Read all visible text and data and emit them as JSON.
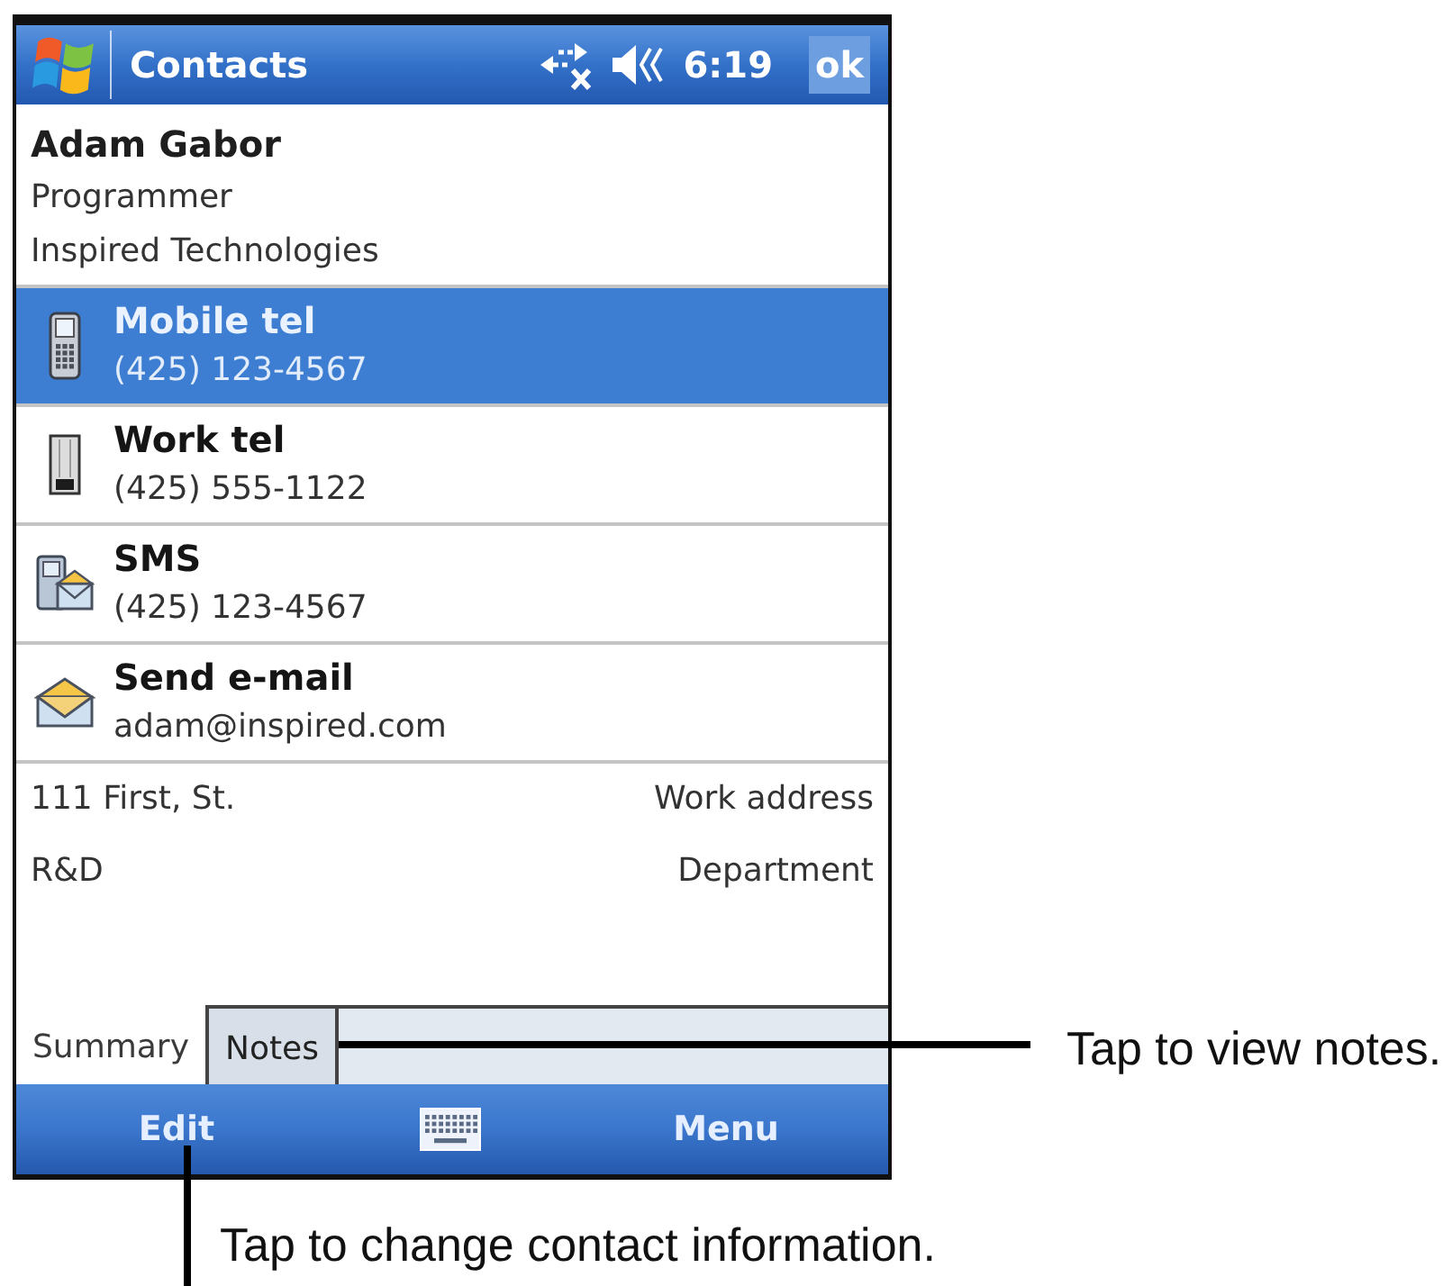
{
  "title_bar": {
    "title": "Contacts",
    "time": "6:19",
    "ok_button": "ok"
  },
  "contact": {
    "name": "Adam Gabor",
    "job_title": "Programmer",
    "company": "Inspired Technologies"
  },
  "actions": [
    {
      "kind": "mobile",
      "label": "Mobile tel",
      "value": "(425) 123-4567",
      "selected": true
    },
    {
      "kind": "work",
      "label": "Work tel",
      "value": "(425) 555-1122",
      "selected": false
    },
    {
      "kind": "sms",
      "label": "SMS",
      "value": "(425) 123-4567",
      "selected": false
    },
    {
      "kind": "email",
      "label": "Send e-mail",
      "value": "adam@inspired.com",
      "selected": false
    }
  ],
  "details": [
    {
      "value": "111 First, St.",
      "label": "Work address"
    },
    {
      "value": "R&D",
      "label": "Department"
    }
  ],
  "tabs": [
    {
      "label": "Summary",
      "selected": true
    },
    {
      "label": "Notes",
      "selected": false
    }
  ],
  "menu_bar": {
    "left": "Edit",
    "right": "Menu"
  },
  "callouts": [
    {
      "text": "Tap to view notes."
    },
    {
      "text": "Tap to change contact information."
    }
  ]
}
